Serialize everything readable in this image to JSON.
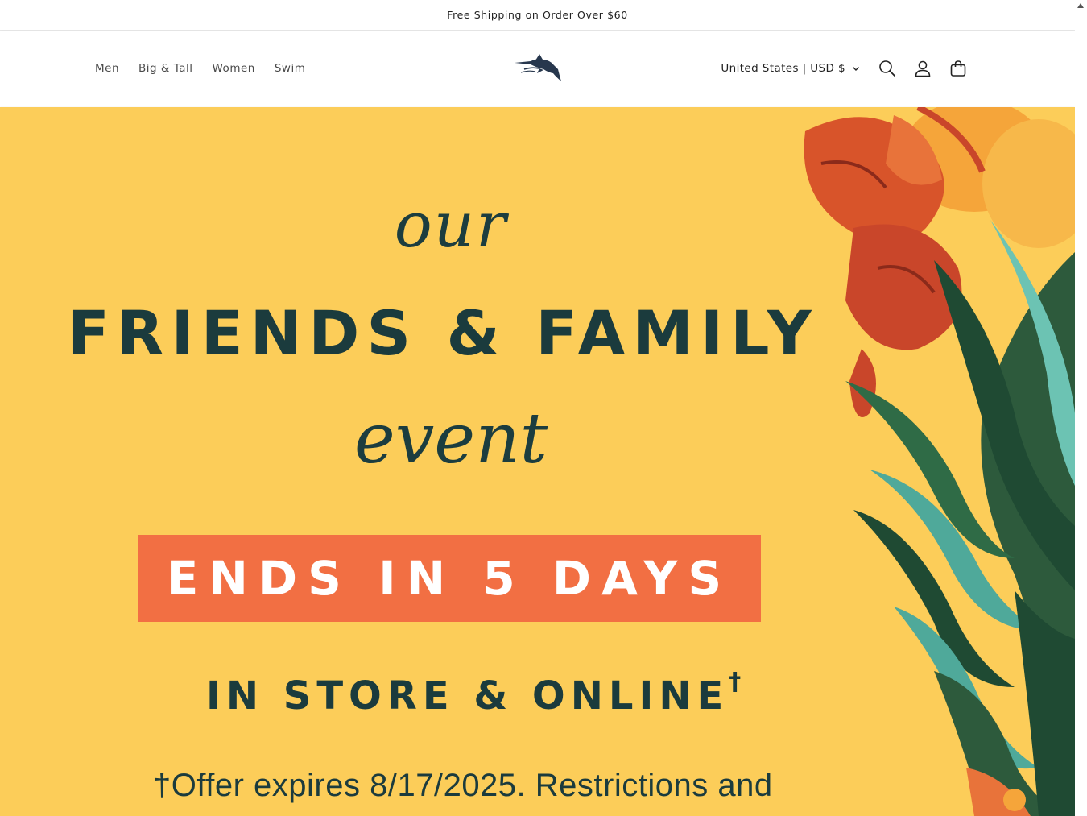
{
  "announcement": {
    "text": "Free Shipping on Order Over $60"
  },
  "nav": {
    "items": [
      "Men",
      "Big & Tall",
      "Women",
      "Swim"
    ]
  },
  "logo": {
    "icon": "marlin-logo-icon"
  },
  "header": {
    "locale_label": "United States | USD $",
    "icons": [
      "search-icon",
      "account-icon",
      "cart-icon"
    ]
  },
  "hero": {
    "line1": "our",
    "line2": "FRIENDS & FAMILY",
    "line3": "event",
    "banner": "ENDS IN 5 DAYS",
    "store": "IN STORE & ONLINE",
    "store_mark": "†",
    "offer": "†Offer expires 8/17/2025. Restrictions and",
    "colors": {
      "background": "#fccd59",
      "banner": "#f26f43",
      "text": "#1b3b3d"
    }
  }
}
